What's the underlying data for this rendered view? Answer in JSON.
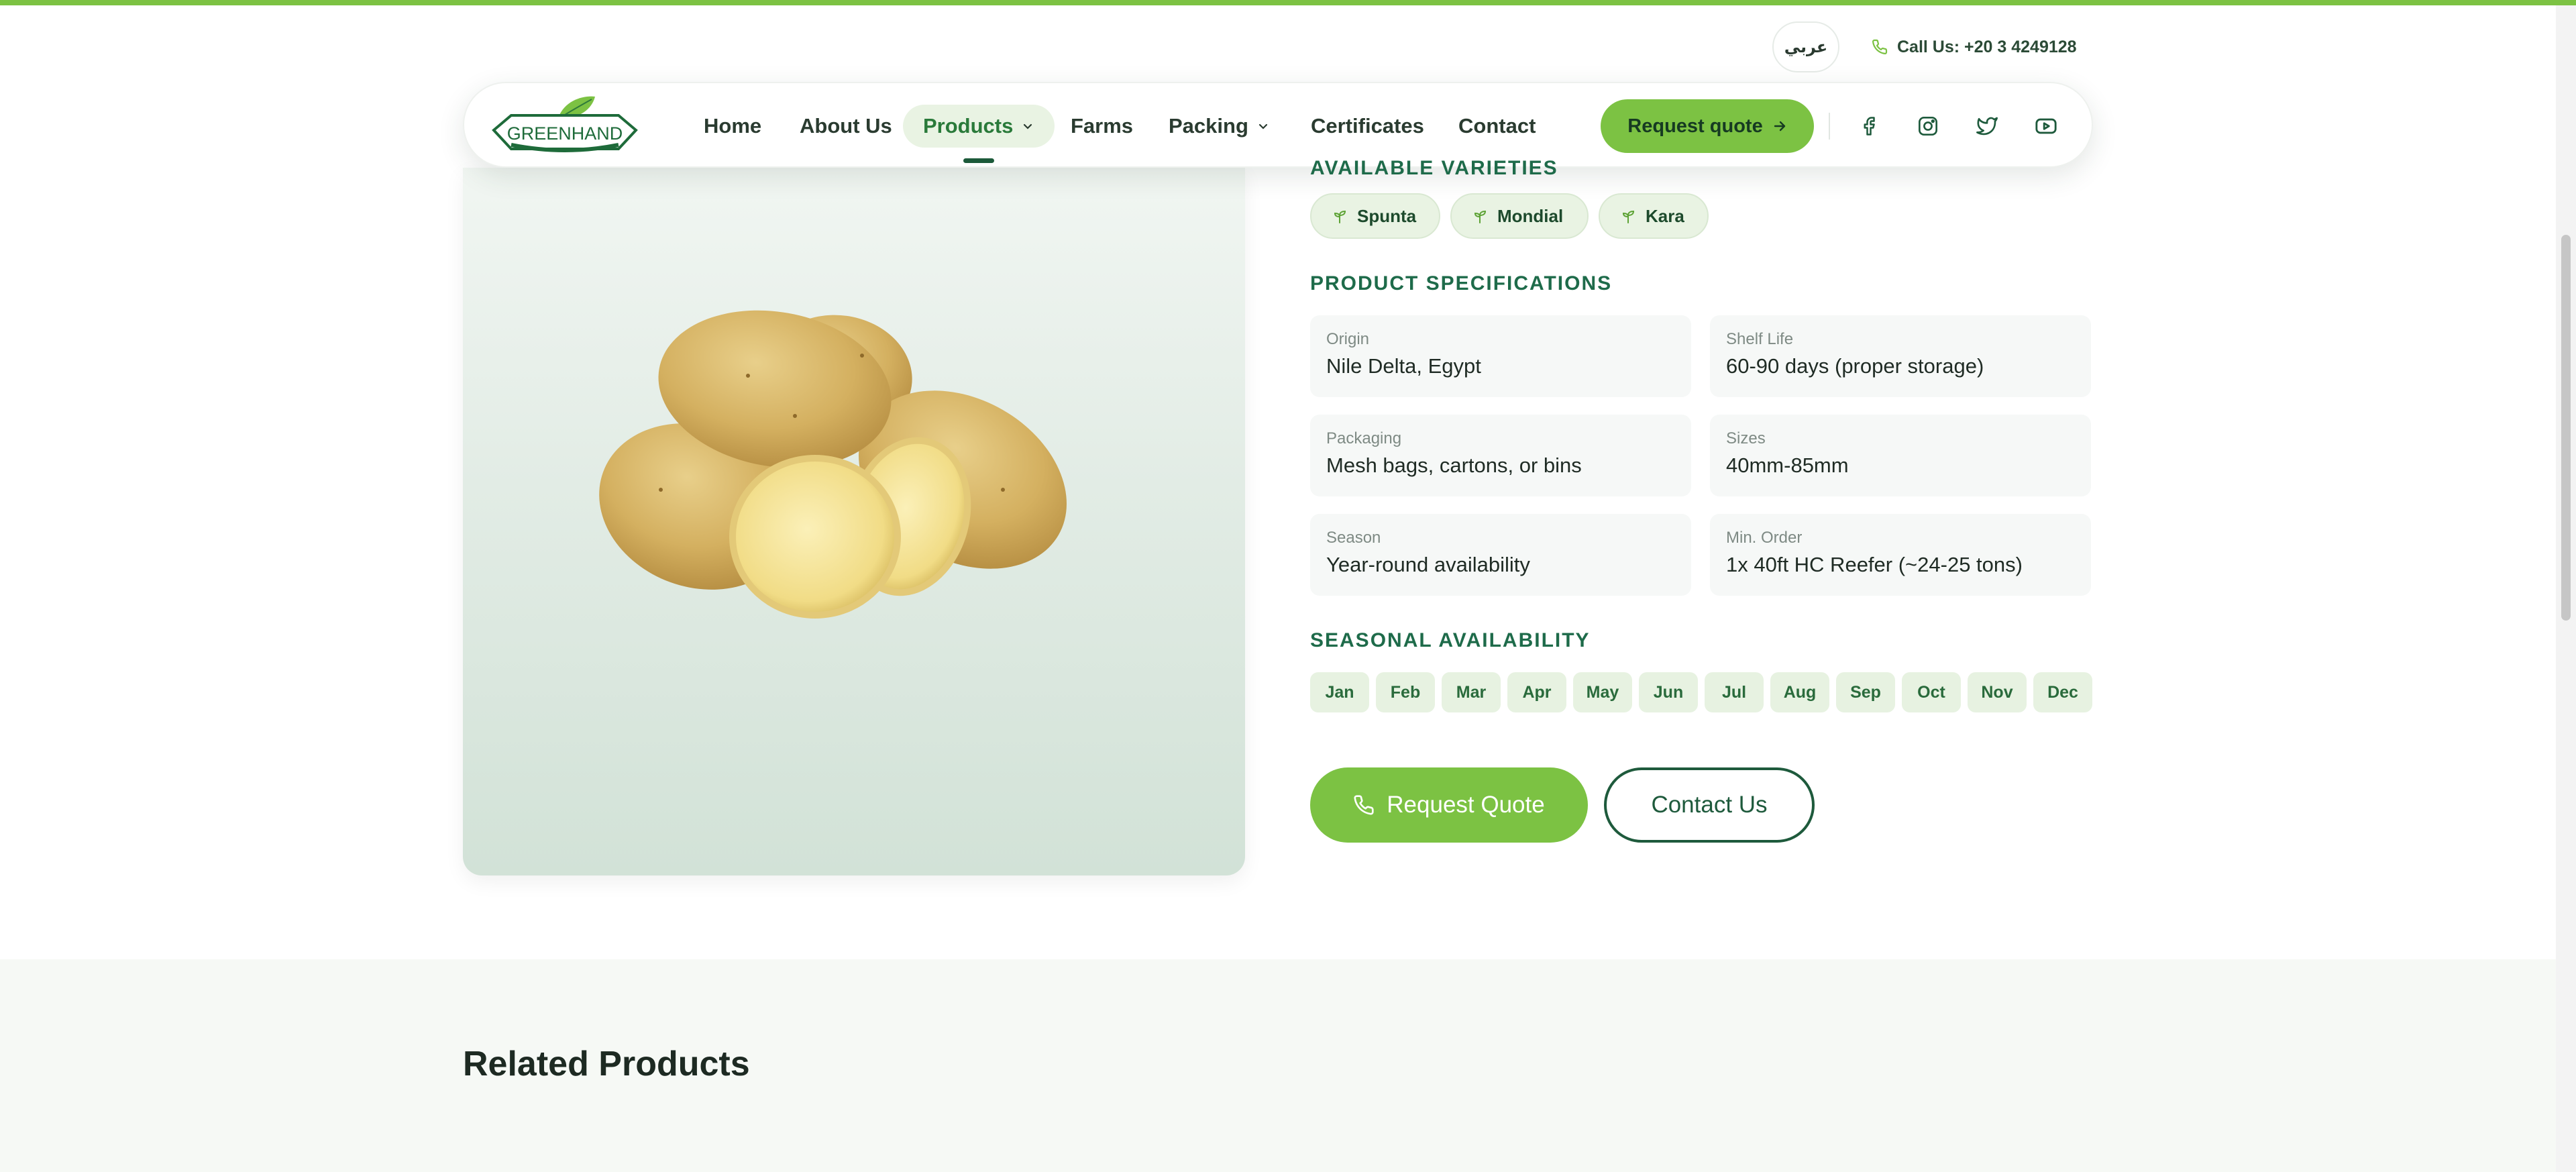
{
  "utility": {
    "language_label": "عربي",
    "call_label": "Call Us: +20 3 4249128"
  },
  "nav": {
    "logo_text": "GREENHAND",
    "items": [
      {
        "label": "Home"
      },
      {
        "label": "About Us"
      },
      {
        "label": "Products",
        "active": true,
        "has_dropdown": true
      },
      {
        "label": "Farms"
      },
      {
        "label": "Packing",
        "has_dropdown": true
      },
      {
        "label": "Certificates"
      },
      {
        "label": "Contact"
      }
    ],
    "request_quote_label": "Request quote",
    "social_icons": [
      "facebook-icon",
      "instagram-icon",
      "twitter-icon",
      "youtube-icon"
    ]
  },
  "product": {
    "varieties_heading": "AVAILABLE VARIETIES",
    "varieties": [
      "Spunta",
      "Mondial",
      "Kara"
    ],
    "specs_heading": "PRODUCT SPECIFICATIONS",
    "specs": [
      {
        "label": "Origin",
        "value": "Nile Delta, Egypt"
      },
      {
        "label": "Shelf Life",
        "value": "60-90 days (proper storage)"
      },
      {
        "label": "Packaging",
        "value": "Mesh bags, cartons, or bins"
      },
      {
        "label": "Sizes",
        "value": "40mm-85mm"
      },
      {
        "label": "Season",
        "value": "Year-round availability"
      },
      {
        "label": "Min. Order",
        "value": "1x 40ft HC Reefer (~24-25 tons)"
      }
    ],
    "seasonal_heading": "SEASONAL AVAILABILITY",
    "months": [
      "Jan",
      "Feb",
      "Mar",
      "Apr",
      "May",
      "Jun",
      "Jul",
      "Aug",
      "Sep",
      "Oct",
      "Nov",
      "Dec"
    ],
    "request_quote_cta": "Request Quote",
    "contact_cta": "Contact Us"
  },
  "related": {
    "title": "Related Products"
  },
  "colors": {
    "accent_green": "#7cc243",
    "dark_green": "#1e5a3c",
    "chip_bg": "#e9f3e3"
  }
}
